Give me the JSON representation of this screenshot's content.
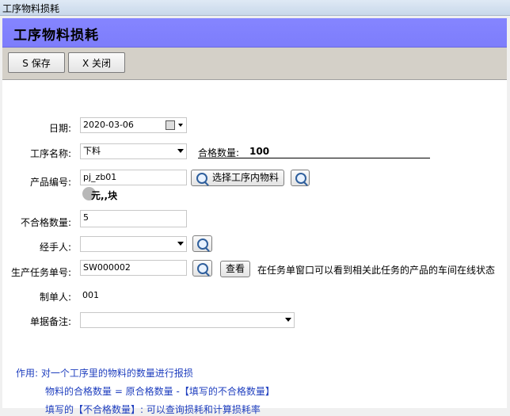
{
  "window": {
    "title": "工序物料损耗"
  },
  "header": {
    "title": "工序物料损耗"
  },
  "toolbar": {
    "save_label": "S 保存",
    "close_label": "X 关闭"
  },
  "form": {
    "date_label": "日期:",
    "date_value": "2020-03-06",
    "process_label": "工序名称:",
    "process_value": "下料",
    "qualified_label": "合格数量:",
    "qualified_value": "100",
    "product_label": "产品编号:",
    "product_value": "pj_zb01",
    "select_material_label": "选择工序内物料",
    "product_info": "元,,块",
    "unqualified_label": "不合格数量:",
    "unqualified_value": "5",
    "handler_label": "经手人:",
    "handler_value": "",
    "task_label": "生产任务单号:",
    "task_value": "SW000002",
    "view_label": "查看",
    "task_hint": "在任务单窗口可以看到相关此任务的产品的车间在线状态",
    "creator_label": "制单人:",
    "creator_value": "001",
    "remark_label": "单据备注:",
    "remark_value": ""
  },
  "notes": {
    "line1": "作用: 对一个工序里的物料的数量进行报损",
    "line2": "物料的合格数量 = 原合格数量 -【填写的不合格数量】",
    "line3": "填写的【不合格数量】: 可以查询损耗和计算损耗率"
  },
  "icons": {
    "calendar": "calendar-icon",
    "search": "magnifier-icon"
  },
  "colors": {
    "header_bg": "#8080ff",
    "note_text": "#1f3fbf"
  }
}
